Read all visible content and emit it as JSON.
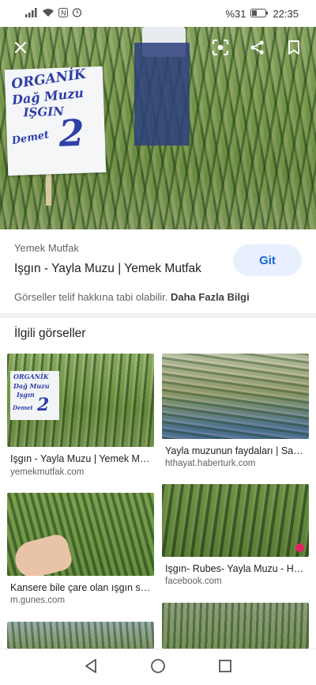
{
  "status_bar": {
    "battery": "%31",
    "time": "22:35"
  },
  "hero": {
    "sign_lines": [
      "ORGANİK",
      "Dağ Muzu",
      "IŞGIN",
      "Demet"
    ],
    "sign_price": "2",
    "sign_currency": "₺"
  },
  "result": {
    "source": "Yemek Mutfak",
    "title": "Işgın - Yayla Muzu | Yemek Mutfak",
    "go_label": "Git",
    "copyright_text": "Görseller telif hakkına tabi olabilir.",
    "more_info": "Daha Fazla Bilgi"
  },
  "related": {
    "heading": "İlgili görseller",
    "items": [
      {
        "title": "Işgın - Yayla Muzu | Yemek Mutfak",
        "source": "yemekmutfak.com"
      },
      {
        "title": "Yayla muzunun faydaları | Sağlık",
        "source": "hthayat.haberturk.com"
      },
      {
        "title": "Kansere bile çare olan ışgın sebzesi",
        "source": "m.gunes.com"
      },
      {
        "title": "Işgın- Rubes- Yayla Muzu - Home",
        "source": "facebook.com"
      }
    ],
    "thumb_sign_lines": [
      "ORGANİK",
      "Dağ Muzu",
      "Işgın",
      "Demet"
    ],
    "thumb_sign_price": "2"
  },
  "icons": {
    "close": "close-icon",
    "lens": "lens-icon",
    "share": "share-icon",
    "bookmark": "bookmark-icon",
    "back": "back-icon",
    "home": "home-icon",
    "recents": "recents-icon"
  },
  "colors": {
    "accent": "#1967d2",
    "go_button_bg": "#e8f0fe",
    "sign_ink": "#2e3fa8"
  }
}
